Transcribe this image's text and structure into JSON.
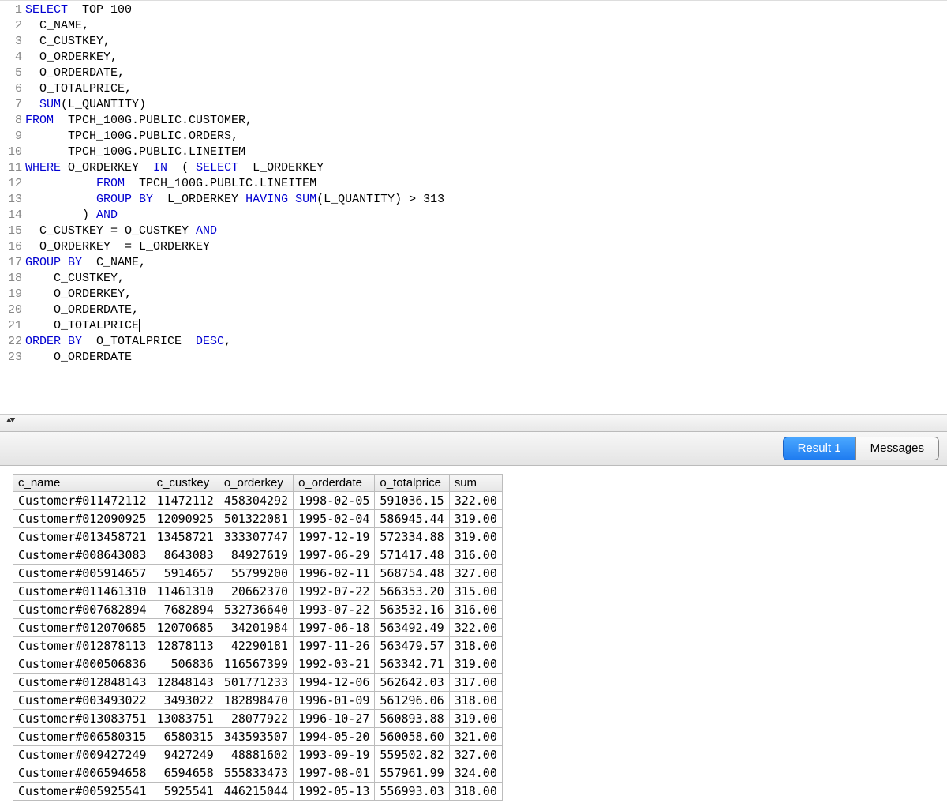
{
  "sql_tokens": [
    [
      {
        "t": "SELECT",
        "c": "kw"
      },
      {
        "t": "  TOP 100"
      }
    ],
    [
      {
        "t": "  C_NAME,"
      }
    ],
    [
      {
        "t": "  C_CUSTKEY,"
      }
    ],
    [
      {
        "t": "  O_ORDERKEY,"
      }
    ],
    [
      {
        "t": "  O_ORDERDATE,"
      }
    ],
    [
      {
        "t": "  O_TOTALPRICE,"
      }
    ],
    [
      {
        "t": "  "
      },
      {
        "t": "SUM",
        "c": "fn"
      },
      {
        "t": "(L_QUANTITY)"
      }
    ],
    [
      {
        "t": "FROM",
        "c": "kw"
      },
      {
        "t": "  TPCH_100G.PUBLIC.CUSTOMER,"
      }
    ],
    [
      {
        "t": "      TPCH_100G.PUBLIC.ORDERS,"
      }
    ],
    [
      {
        "t": "      TPCH_100G.PUBLIC.LINEITEM"
      }
    ],
    [
      {
        "t": "WHERE",
        "c": "kw"
      },
      {
        "t": " O_ORDERKEY  "
      },
      {
        "t": "IN",
        "c": "kw"
      },
      {
        "t": "  ( "
      },
      {
        "t": "SELECT",
        "c": "kw"
      },
      {
        "t": "  L_ORDERKEY"
      }
    ],
    [
      {
        "t": "          "
      },
      {
        "t": "FROM",
        "c": "kw"
      },
      {
        "t": "  TPCH_100G.PUBLIC.LINEITEM"
      }
    ],
    [
      {
        "t": "          "
      },
      {
        "t": "GROUP BY",
        "c": "kw"
      },
      {
        "t": "  L_ORDERKEY "
      },
      {
        "t": "HAVING",
        "c": "kw"
      },
      {
        "t": " "
      },
      {
        "t": "SUM",
        "c": "fn"
      },
      {
        "t": "(L_QUANTITY) > 313"
      }
    ],
    [
      {
        "t": "        ) "
      },
      {
        "t": "AND",
        "c": "kw"
      }
    ],
    [
      {
        "t": "  C_CUSTKEY = O_CUSTKEY "
      },
      {
        "t": "AND",
        "c": "kw"
      }
    ],
    [
      {
        "t": "  O_ORDERKEY  = L_ORDERKEY"
      }
    ],
    [
      {
        "t": "GROUP BY",
        "c": "kw"
      },
      {
        "t": "  C_NAME,"
      }
    ],
    [
      {
        "t": "    C_CUSTKEY,"
      }
    ],
    [
      {
        "t": "    O_ORDERKEY,"
      }
    ],
    [
      {
        "t": "    O_ORDERDATE,"
      }
    ],
    [
      {
        "t": "    O_TOTALPRICE",
        "cursor": true
      }
    ],
    [
      {
        "t": "ORDER BY",
        "c": "kw"
      },
      {
        "t": "  O_TOTALPRICE  "
      },
      {
        "t": "DESC",
        "c": "kw"
      },
      {
        "t": ","
      }
    ],
    [
      {
        "t": "    O_ORDERDATE"
      }
    ]
  ],
  "tabs": {
    "result_label": "Result 1",
    "messages_label": "Messages"
  },
  "results": {
    "columns": [
      "c_name",
      "c_custkey",
      "o_orderkey",
      "o_orderdate",
      "o_totalprice",
      "sum"
    ],
    "numeric_cols": [
      false,
      true,
      true,
      false,
      true,
      true
    ],
    "rows": [
      [
        "Customer#011472112",
        "11472112",
        "458304292",
        "1998-02-05",
        "591036.15",
        "322.00"
      ],
      [
        "Customer#012090925",
        "12090925",
        "501322081",
        "1995-02-04",
        "586945.44",
        "319.00"
      ],
      [
        "Customer#013458721",
        "13458721",
        "333307747",
        "1997-12-19",
        "572334.88",
        "319.00"
      ],
      [
        "Customer#008643083",
        "8643083",
        "84927619",
        "1997-06-29",
        "571417.48",
        "316.00"
      ],
      [
        "Customer#005914657",
        "5914657",
        "55799200",
        "1996-02-11",
        "568754.48",
        "327.00"
      ],
      [
        "Customer#011461310",
        "11461310",
        "20662370",
        "1992-07-22",
        "566353.20",
        "315.00"
      ],
      [
        "Customer#007682894",
        "7682894",
        "532736640",
        "1993-07-22",
        "563532.16",
        "316.00"
      ],
      [
        "Customer#012070685",
        "12070685",
        "34201984",
        "1997-06-18",
        "563492.49",
        "322.00"
      ],
      [
        "Customer#012878113",
        "12878113",
        "42290181",
        "1997-11-26",
        "563479.57",
        "318.00"
      ],
      [
        "Customer#000506836",
        "506836",
        "116567399",
        "1992-03-21",
        "563342.71",
        "319.00"
      ],
      [
        "Customer#012848143",
        "12848143",
        "501771233",
        "1994-12-06",
        "562642.03",
        "317.00"
      ],
      [
        "Customer#003493022",
        "3493022",
        "182898470",
        "1996-01-09",
        "561296.06",
        "318.00"
      ],
      [
        "Customer#013083751",
        "13083751",
        "28077922",
        "1996-10-27",
        "560893.88",
        "319.00"
      ],
      [
        "Customer#006580315",
        "6580315",
        "343593507",
        "1994-05-20",
        "560058.60",
        "321.00"
      ],
      [
        "Customer#009427249",
        "9427249",
        "48881602",
        "1993-09-19",
        "559502.82",
        "327.00"
      ],
      [
        "Customer#006594658",
        "6594658",
        "555833473",
        "1997-08-01",
        "557961.99",
        "324.00"
      ],
      [
        "Customer#005925541",
        "5925541",
        "446215044",
        "1992-05-13",
        "556993.03",
        "318.00"
      ]
    ]
  }
}
